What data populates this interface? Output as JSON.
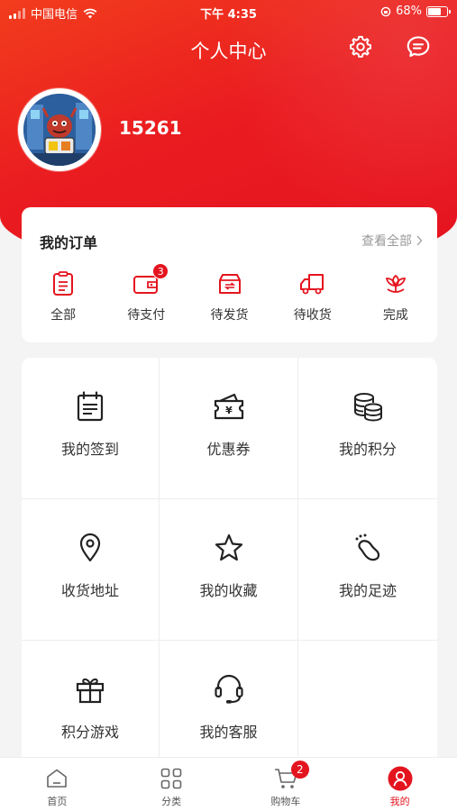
{
  "status_bar": {
    "carrier": "中国电信",
    "time": "下午 4:35",
    "battery": "68%",
    "battery_level": 0.68
  },
  "header": {
    "title": "个人中心",
    "settings_icon": "gear-icon",
    "message_icon": "chat-icon"
  },
  "profile": {
    "username": "15261"
  },
  "orders": {
    "title": "我的订单",
    "view_all": "查看全部",
    "items": [
      {
        "label": "全部",
        "icon": "clipboard-icon",
        "badge": ""
      },
      {
        "label": "待支付",
        "icon": "wallet-icon",
        "badge": "3"
      },
      {
        "label": "待发货",
        "icon": "package-icon",
        "badge": ""
      },
      {
        "label": "待收货",
        "icon": "truck-icon",
        "badge": ""
      },
      {
        "label": "完成",
        "icon": "flower-icon",
        "badge": ""
      }
    ]
  },
  "features": [
    {
      "label": "我的签到",
      "icon": "calendar-icon"
    },
    {
      "label": "优惠券",
      "icon": "coupon-icon"
    },
    {
      "label": "我的积分",
      "icon": "coins-icon"
    },
    {
      "label": "收货地址",
      "icon": "location-pin-icon"
    },
    {
      "label": "我的收藏",
      "icon": "star-icon"
    },
    {
      "label": "我的足迹",
      "icon": "footprint-icon"
    },
    {
      "label": "积分游戏",
      "icon": "gift-icon"
    },
    {
      "label": "我的客服",
      "icon": "headset-icon"
    }
  ],
  "tabs": [
    {
      "label": "首页",
      "icon": "home-icon",
      "badge": ""
    },
    {
      "label": "分类",
      "icon": "grid-icon",
      "badge": ""
    },
    {
      "label": "购物车",
      "icon": "cart-icon",
      "badge": "2"
    },
    {
      "label": "我的",
      "icon": "user-icon",
      "badge": ""
    }
  ],
  "colors": {
    "brand": "#e4141e",
    "header_gradient_start": "#f23d1d"
  }
}
